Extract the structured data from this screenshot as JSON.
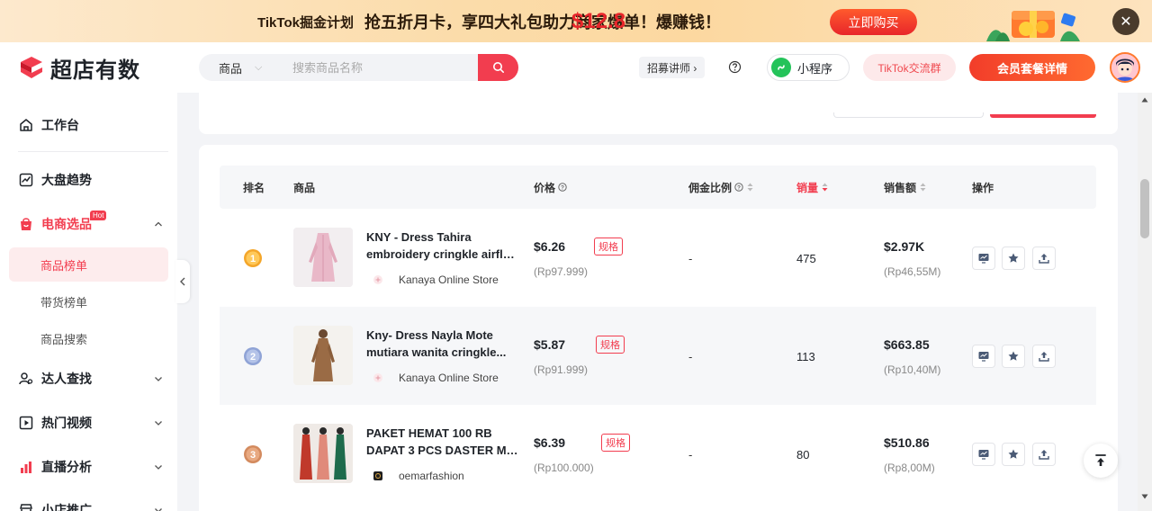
{
  "banner": {
    "plan": "TikTok掘金计划",
    "price": "$12.8",
    "slogan": "抢五折月卡，享四大礼包助力商家爆单！爆赚钱！",
    "buy_button": "立即购买",
    "close": "✕"
  },
  "header": {
    "logo": "超店有数",
    "search_category": "商品",
    "search_placeholder": "搜索商品名称",
    "recruit": "招募讲师 ›",
    "mini_program": "小程序",
    "tiktok_group": "TikTok交流群",
    "vip": "会员套餐详情"
  },
  "sidebar": {
    "workbench": "工作台",
    "market_trend": "大盘趋势",
    "ecommerce": "电商选品",
    "hot_badge": "Hot",
    "sub_product_rank": "商品榜单",
    "sub_sales_rank": "带货榜单",
    "sub_product_search": "商品搜索",
    "influencer": "达人查找",
    "hot_video": "热门视频",
    "live": "直播分析",
    "shop": "小店推广"
  },
  "table": {
    "headers": {
      "rank": "排名",
      "product": "商品",
      "price": "价格",
      "commission": "佣金比例",
      "sales": "销量",
      "gmv": "销售额",
      "ops": "操作"
    },
    "spec_label": "规格",
    "rows": [
      {
        "rank": 1,
        "name_line1": "KNY - Dress Tahira",
        "name_line2": "embroidery cringkle airflo...",
        "shop": "Kanaya Online Store",
        "price": "$6.26",
        "price_local": "(Rp97.999)",
        "commission": "-",
        "sales": "475",
        "gmv": "$2.97K",
        "gmv_local": "(Rp46,55M)"
      },
      {
        "rank": 2,
        "name_line1": "Kny- Dress Nayla Mote",
        "name_line2": "mutiara wanita cringkle...",
        "shop": "Kanaya Online Store",
        "price": "$5.87",
        "price_local": "(Rp91.999)",
        "commission": "-",
        "sales": "113",
        "gmv": "$663.85",
        "gmv_local": "(Rp10,40M)"
      },
      {
        "rank": 3,
        "name_line1": "PAKET HEMAT 100 RB",
        "name_line2": "DAPAT 3 PCS DASTER MO...",
        "shop": "oemarfashion",
        "price": "$6.39",
        "price_local": "(Rp100.000)",
        "commission": "-",
        "sales": "80",
        "gmv": "$510.86",
        "gmv_local": "(Rp8,00M)"
      }
    ]
  },
  "colors": {
    "accent": "#f23d4f",
    "gold": "#f4a62a",
    "silver": "#8fa3d6",
    "bronze": "#d38a5e"
  }
}
